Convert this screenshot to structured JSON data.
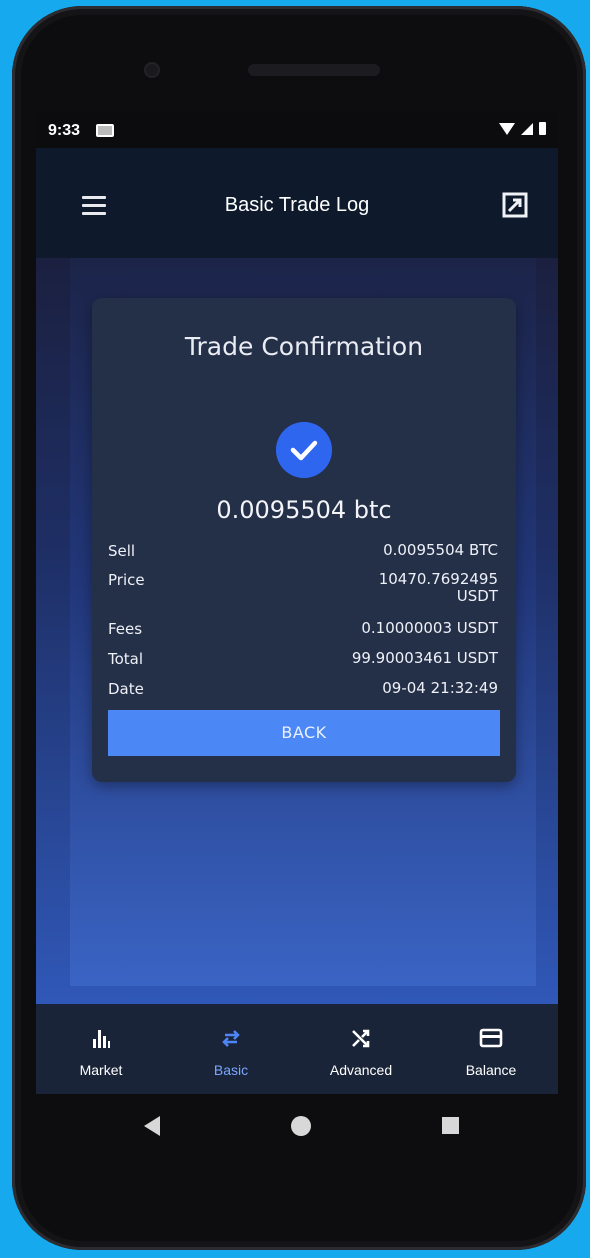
{
  "status": {
    "time": "9:33"
  },
  "appbar": {
    "title": "Basic Trade Log"
  },
  "card": {
    "title": "Trade Confirmation",
    "amount": "0.0095504 btc",
    "rows": [
      {
        "label": "Sell",
        "value": "0.0095504 BTC"
      },
      {
        "label": "Price",
        "value_line1": "10470.7692495",
        "value_line2": "USDT"
      },
      {
        "label": "Fees",
        "value": "0.10000003 USDT"
      },
      {
        "label": "Total",
        "value": "99.90003461 USDT"
      },
      {
        "label": "Date",
        "value": "09-04 21:32:49"
      }
    ],
    "back_label": "BACK"
  },
  "nav": [
    {
      "label": "Market",
      "icon": "bar-chart-icon",
      "active": false
    },
    {
      "label": "Basic",
      "icon": "swap-arrows-icon",
      "active": true
    },
    {
      "label": "Advanced",
      "icon": "shuffle-icon",
      "active": false
    },
    {
      "label": "Balance",
      "icon": "credit-card-icon",
      "active": false
    }
  ],
  "colors": {
    "accent": "#4b88f5",
    "check": "#2f66ef",
    "card": "#242f48",
    "active_nav": "#7aa6ff"
  }
}
